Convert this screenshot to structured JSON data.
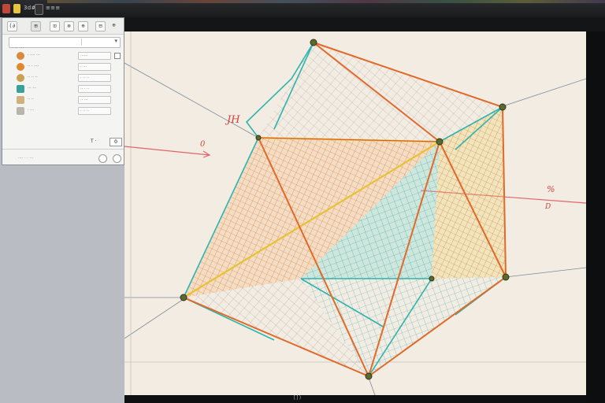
{
  "toolbar": {
    "app_label": "3d#",
    "mode_label": "≡≡≡",
    "buttons": [
      "red-square",
      "yellow-square",
      "view-toggle"
    ]
  },
  "sidebar": {
    "tools": [
      "(∂",
      "⊞",
      "⌂",
      "⊡",
      "⊗",
      "⊕",
      "⊞",
      "⊟",
      "⊟",
      "⊞",
      "⊕"
    ],
    "search_placeholder": "· ·· ···",
    "layers": [
      {
        "name": "· ···· ···",
        "value": "······",
        "color": "#d98a3c"
      },
      {
        "name": "·· · ····",
        "value": "· ···",
        "color": "#e0892f"
      },
      {
        "name": "·· ·· ··",
        "value": "· ·· ··",
        "color": "#caa052"
      },
      {
        "name": "··· ···",
        "value": "·· · ··",
        "color": "#3aa09a"
      },
      {
        "name": "·· ··",
        "value": "·· ···",
        "color": "#d2b07c"
      },
      {
        "name": "· ···",
        "value": "· ·· ··",
        "color": "#b8b6aa"
      }
    ],
    "coord_label": "T ·",
    "coord_value": "0",
    "footer_text": "···· · · ···"
  },
  "canvas": {
    "annotations": [
      "JH",
      "0",
      "%",
      "D"
    ],
    "colors": {
      "orange": "#e06a2a",
      "teal": "#2fb3ad",
      "yellow": "#e9c233",
      "red_axis": "#e0646a",
      "paper": "#f3ece3"
    }
  },
  "status": {
    "text": "[])"
  }
}
